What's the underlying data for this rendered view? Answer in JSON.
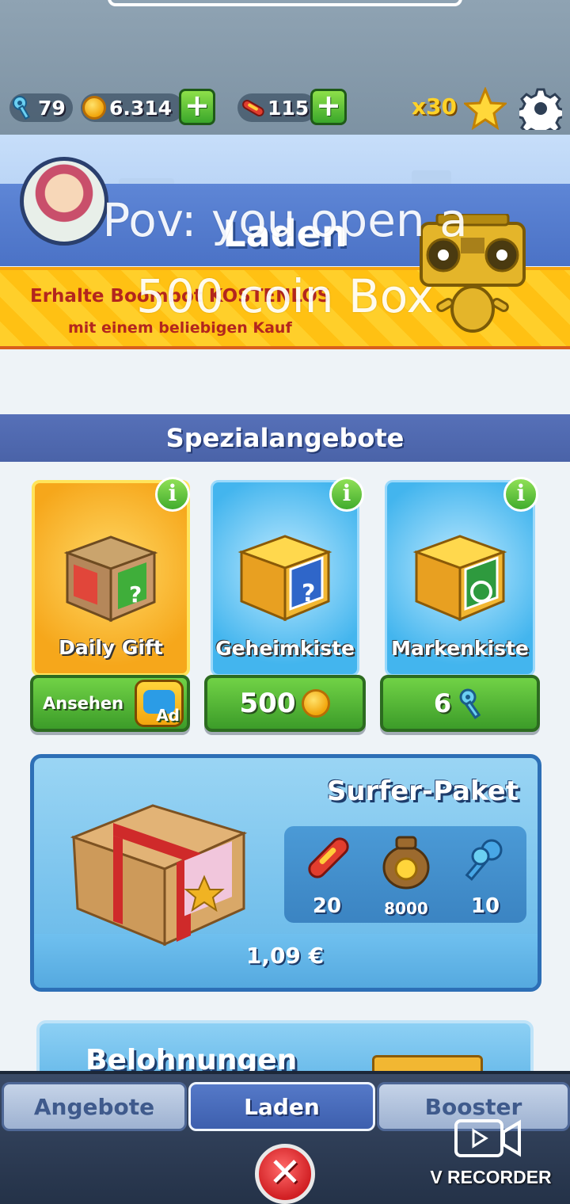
{
  "currency_bar": {
    "keys": "79",
    "coins": "6.314",
    "hoverboards": "115",
    "multiplier": "x30",
    "add_label": "+"
  },
  "banner": {
    "title": "Laden",
    "promo_line1": "Erhalte Boombot KOSTENLOS",
    "promo_line2": "mit einem beliebigen Kauf"
  },
  "overlay": {
    "line1": "Pov: you open a",
    "line2": "500 coin Box"
  },
  "special_offers": {
    "header": "Spezialangebote",
    "info_label": "i",
    "cards": [
      {
        "label": "Daily Gift",
        "button": "Ansehen",
        "ad_label": "Ad"
      },
      {
        "label": "Geheimkiste",
        "button": "500"
      },
      {
        "label": "Markenkiste",
        "button": "6"
      }
    ]
  },
  "surfer_pack": {
    "title": "Surfer-Paket",
    "items": [
      {
        "icon": "hoverboard-icon",
        "value": "20"
      },
      {
        "icon": "coin-bag-icon",
        "value": "8000"
      },
      {
        "icon": "keys-icon",
        "value": "10"
      }
    ],
    "price": "1,09 €"
  },
  "next_card": {
    "title": "Belohnungen"
  },
  "bottom_nav": {
    "tabs": [
      "Angebote",
      "Laden",
      "Booster"
    ],
    "active": "Laden",
    "close_label": "✕"
  },
  "watermark": {
    "label": "V RECORDER"
  },
  "colors": {
    "green_button": "#3c9c29",
    "nav_active": "#3d5fae",
    "promo_yellow": "#ffc113",
    "close_red": "#d11f23"
  }
}
